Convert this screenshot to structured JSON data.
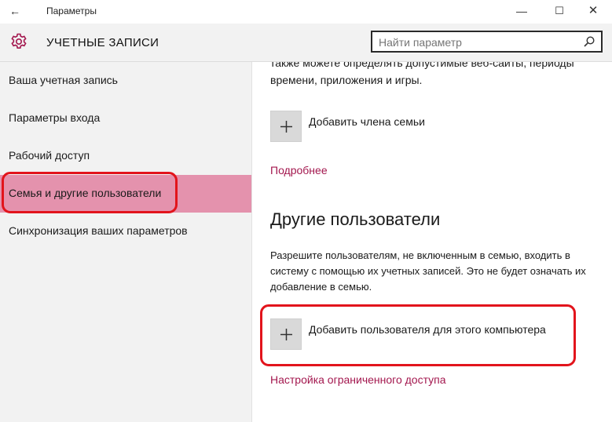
{
  "window": {
    "title": "Параметры",
    "controls": {
      "minimize": "—",
      "maximize": "☐",
      "close": "✕"
    }
  },
  "header": {
    "section_title": "УЧЕТНЫЕ ЗАПИСИ",
    "search_placeholder": "Найти параметр",
    "icon": "gear-icon"
  },
  "sidebar": {
    "items": [
      {
        "label": "Ваша учетная запись",
        "active": false
      },
      {
        "label": "Параметры входа",
        "active": false
      },
      {
        "label": "Рабочий доступ",
        "active": false
      },
      {
        "label": "Семья и другие пользователи",
        "active": true
      },
      {
        "label": "Синхронизация ваших параметров",
        "active": false
      }
    ]
  },
  "content": {
    "family_text": "также можете определять допустимые веб-сайты, периоды времени, приложения и игры.",
    "add_family_label": "Добавить члена семьи",
    "more_link": "Подробнее",
    "other_users_heading": "Другие пользователи",
    "other_users_text": "Разрешите пользователям, не включенным в семью, входить в систему с помощью их учетных записей. Это не будет означать их добавление в семью.",
    "add_user_label": "Добавить пользователя для этого компьютера",
    "restricted_link": "Настройка ограниченного доступа"
  },
  "colors": {
    "accent": "#a3174e",
    "active_item_bg": "#e492ad",
    "highlight_border": "#e2141c"
  }
}
